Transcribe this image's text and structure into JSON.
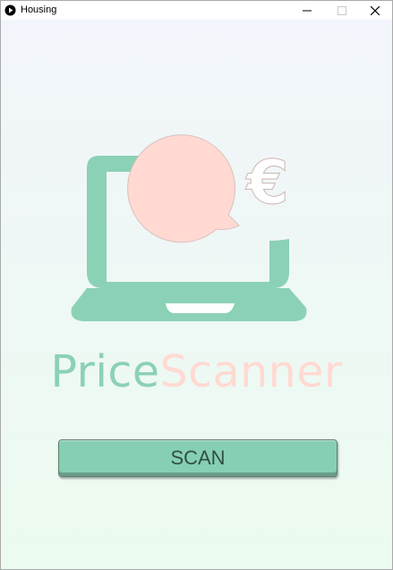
{
  "window": {
    "title": "Housing",
    "controls": {
      "minimize_icon": "minimize-icon",
      "maximize_icon": "maximize-icon",
      "close_icon": "close-icon"
    }
  },
  "logo": {
    "currency_symbol": "€",
    "brand_part1": "Price",
    "brand_part2": "Scanner"
  },
  "colors": {
    "green": "#8bd1b5",
    "pink": "#ffd9d2",
    "pink_symbol": "#ffffff"
  },
  "button": {
    "scan_label": "SCAN"
  }
}
